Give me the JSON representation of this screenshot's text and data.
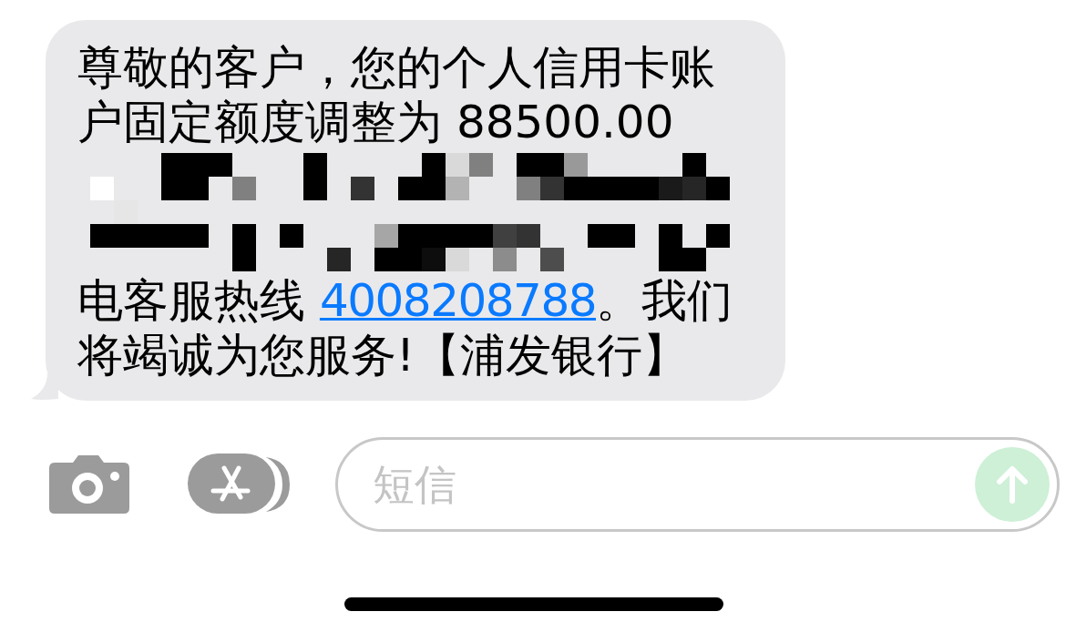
{
  "message": {
    "text_before": "尊敬的客户，您的个人信用卡账户固定额度调整为 88500.00",
    "text_after": "电客服热线 ",
    "phone_link": "4008208788",
    "text_end": "。我们将竭诚为您服务!【浦发银行】"
  },
  "composer": {
    "placeholder": "短信",
    "send_disabled": true
  }
}
